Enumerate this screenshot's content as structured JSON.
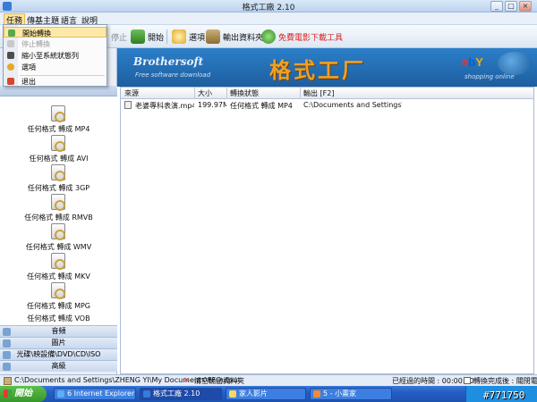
{
  "window": {
    "title": "格式工廠 2.10"
  },
  "menu": {
    "items": [
      "任務",
      "傳基主題",
      "語言",
      "說明"
    ]
  },
  "toolbar": {
    "stop_label": "停止",
    "start_label": "開始",
    "options_label": "選項",
    "output_folder_label": "輸出資料夾",
    "free_download_label": "免費電影下載工具"
  },
  "dropdown": {
    "items": [
      {
        "label": "開始轉換",
        "state": "highlighted"
      },
      {
        "label": "停止轉換",
        "state": "disabled"
      },
      {
        "label": "縮小至系統狀態列",
        "state": "normal"
      },
      {
        "label": "選項",
        "state": "normal"
      },
      {
        "label": "退出",
        "state": "normal"
      }
    ]
  },
  "banner": {
    "brand": "Brothersoft",
    "brand_sub": "Free software download",
    "title": "格式工厂",
    "ebay": "ebY",
    "shop": "shopping online"
  },
  "sidebar": {
    "formats": [
      "任何格式 轉成 MP4",
      "任何格式 轉成 AVI",
      "任何格式 轉成 3GP",
      "任何格式 轉成 RMVB",
      "任何格式 轉成 WMV",
      "任何格式 轉成 MKV",
      "任何格式 轉成 MPG",
      "任何格式 轉成 VOB"
    ],
    "categories": [
      "音頻",
      "圖片",
      "光碟\\映設備\\DVD\\CD\\ISO",
      "高級"
    ]
  },
  "grid": {
    "columns": [
      "來源",
      "大小",
      "轉換狀態",
      "輸出 [F2]"
    ],
    "rows": [
      [
        "老婆專科表演.mp4",
        "199.97M",
        "任何格式 轉成 MP4",
        "C:\\Documents and Settings\\ZHENG"
      ]
    ]
  },
  "statusbar": {
    "output_path": "C:\\Documents and Settings\\ZHENG YI\\My Documents\\FFOutput",
    "clear_output": "清空輸出資料夾",
    "elapsed": "已經過的時間 : 00:00:00",
    "after_convert": "轉換完成後 : 關閉電腦"
  },
  "taskbar": {
    "start_label": "開始",
    "tasks": [
      "6 Internet Explorer",
      "格式工廠 2.10",
      "家人影片",
      "5 - 小畫家"
    ]
  },
  "watermark": "#771750",
  "colors": {
    "accent": "#2b7fca",
    "highlight": "#fde8a8",
    "taskbar": "#245ec4"
  }
}
